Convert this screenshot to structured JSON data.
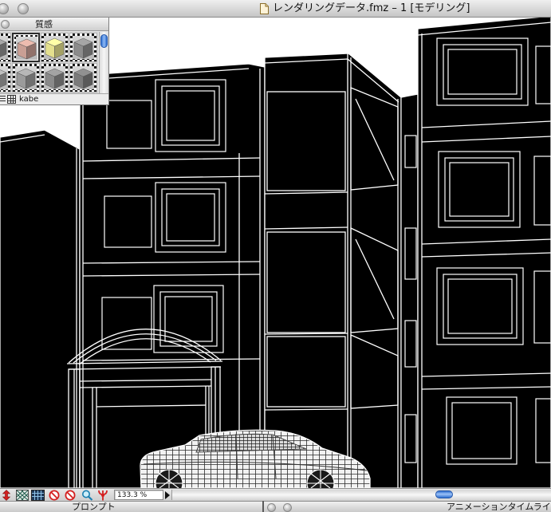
{
  "window": {
    "title": "レンダリングデータ.fmz – 1 [モデリング]",
    "icon": "document-icon"
  },
  "materials_palette": {
    "title": "質感",
    "current_material": "kabe",
    "selected_index": 1,
    "swatches": [
      {
        "color": "#8f8f8f"
      },
      {
        "color": "#c99f94"
      },
      {
        "color": "#e4e08e"
      },
      {
        "color": "#8c8c8c"
      },
      {
        "color": "#a3a3a3"
      },
      {
        "color": "#9b9b9b"
      },
      {
        "color": "#8a8a8a"
      },
      {
        "color": "#7b7b7b"
      }
    ],
    "footer_icons": [
      "list-view-icon",
      "grid-view-icon"
    ]
  },
  "viewport": {
    "background": "#000000",
    "wireframe_color": "#ffffff"
  },
  "status_bar": {
    "zoom": "133.3 %",
    "tools": [
      "arrow-tool-icon",
      "hatch-toggle-icon",
      "grid-toggle-icon",
      "no-entry-icon",
      "no-entry-icon",
      "magnifier-icon",
      "handle-tool-icon"
    ]
  },
  "bottom_windows": {
    "prompt_title": "プロンプト",
    "timeline_title": "アニメーションタイムライ"
  },
  "colors": {
    "accent": "#2f6fd0",
    "tool_red": "#d42020"
  }
}
